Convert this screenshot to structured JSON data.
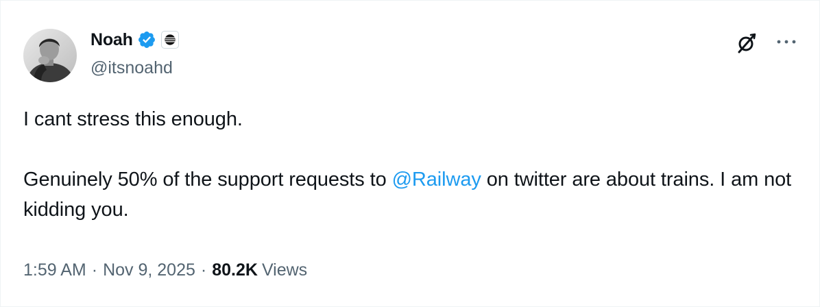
{
  "tweet": {
    "author": {
      "name": "Noah",
      "handle": "@itsnoahd",
      "verified": true,
      "avatar_icon": "profile-photo",
      "affiliation_icon": "railway-logo-icon"
    },
    "text": {
      "line1": "I cant stress this enough.",
      "para2_prefix": "Genuinely 50% of the support requests to ",
      "mention": "@Railway",
      "para2_suffix": " on twitter are about trains. I am not kidding you."
    },
    "meta": {
      "time": "1:59 AM",
      "separator": "·",
      "date": "Nov 9, 2025",
      "views_count": "80.2K",
      "views_label": "Views"
    },
    "actions": {
      "grok_icon": "grok-icon",
      "more_icon": "more-icon"
    },
    "colors": {
      "text": "#0f1419",
      "secondary": "#536471",
      "link": "#1d9bf0",
      "verified_badge": "#1d9bf0"
    }
  }
}
